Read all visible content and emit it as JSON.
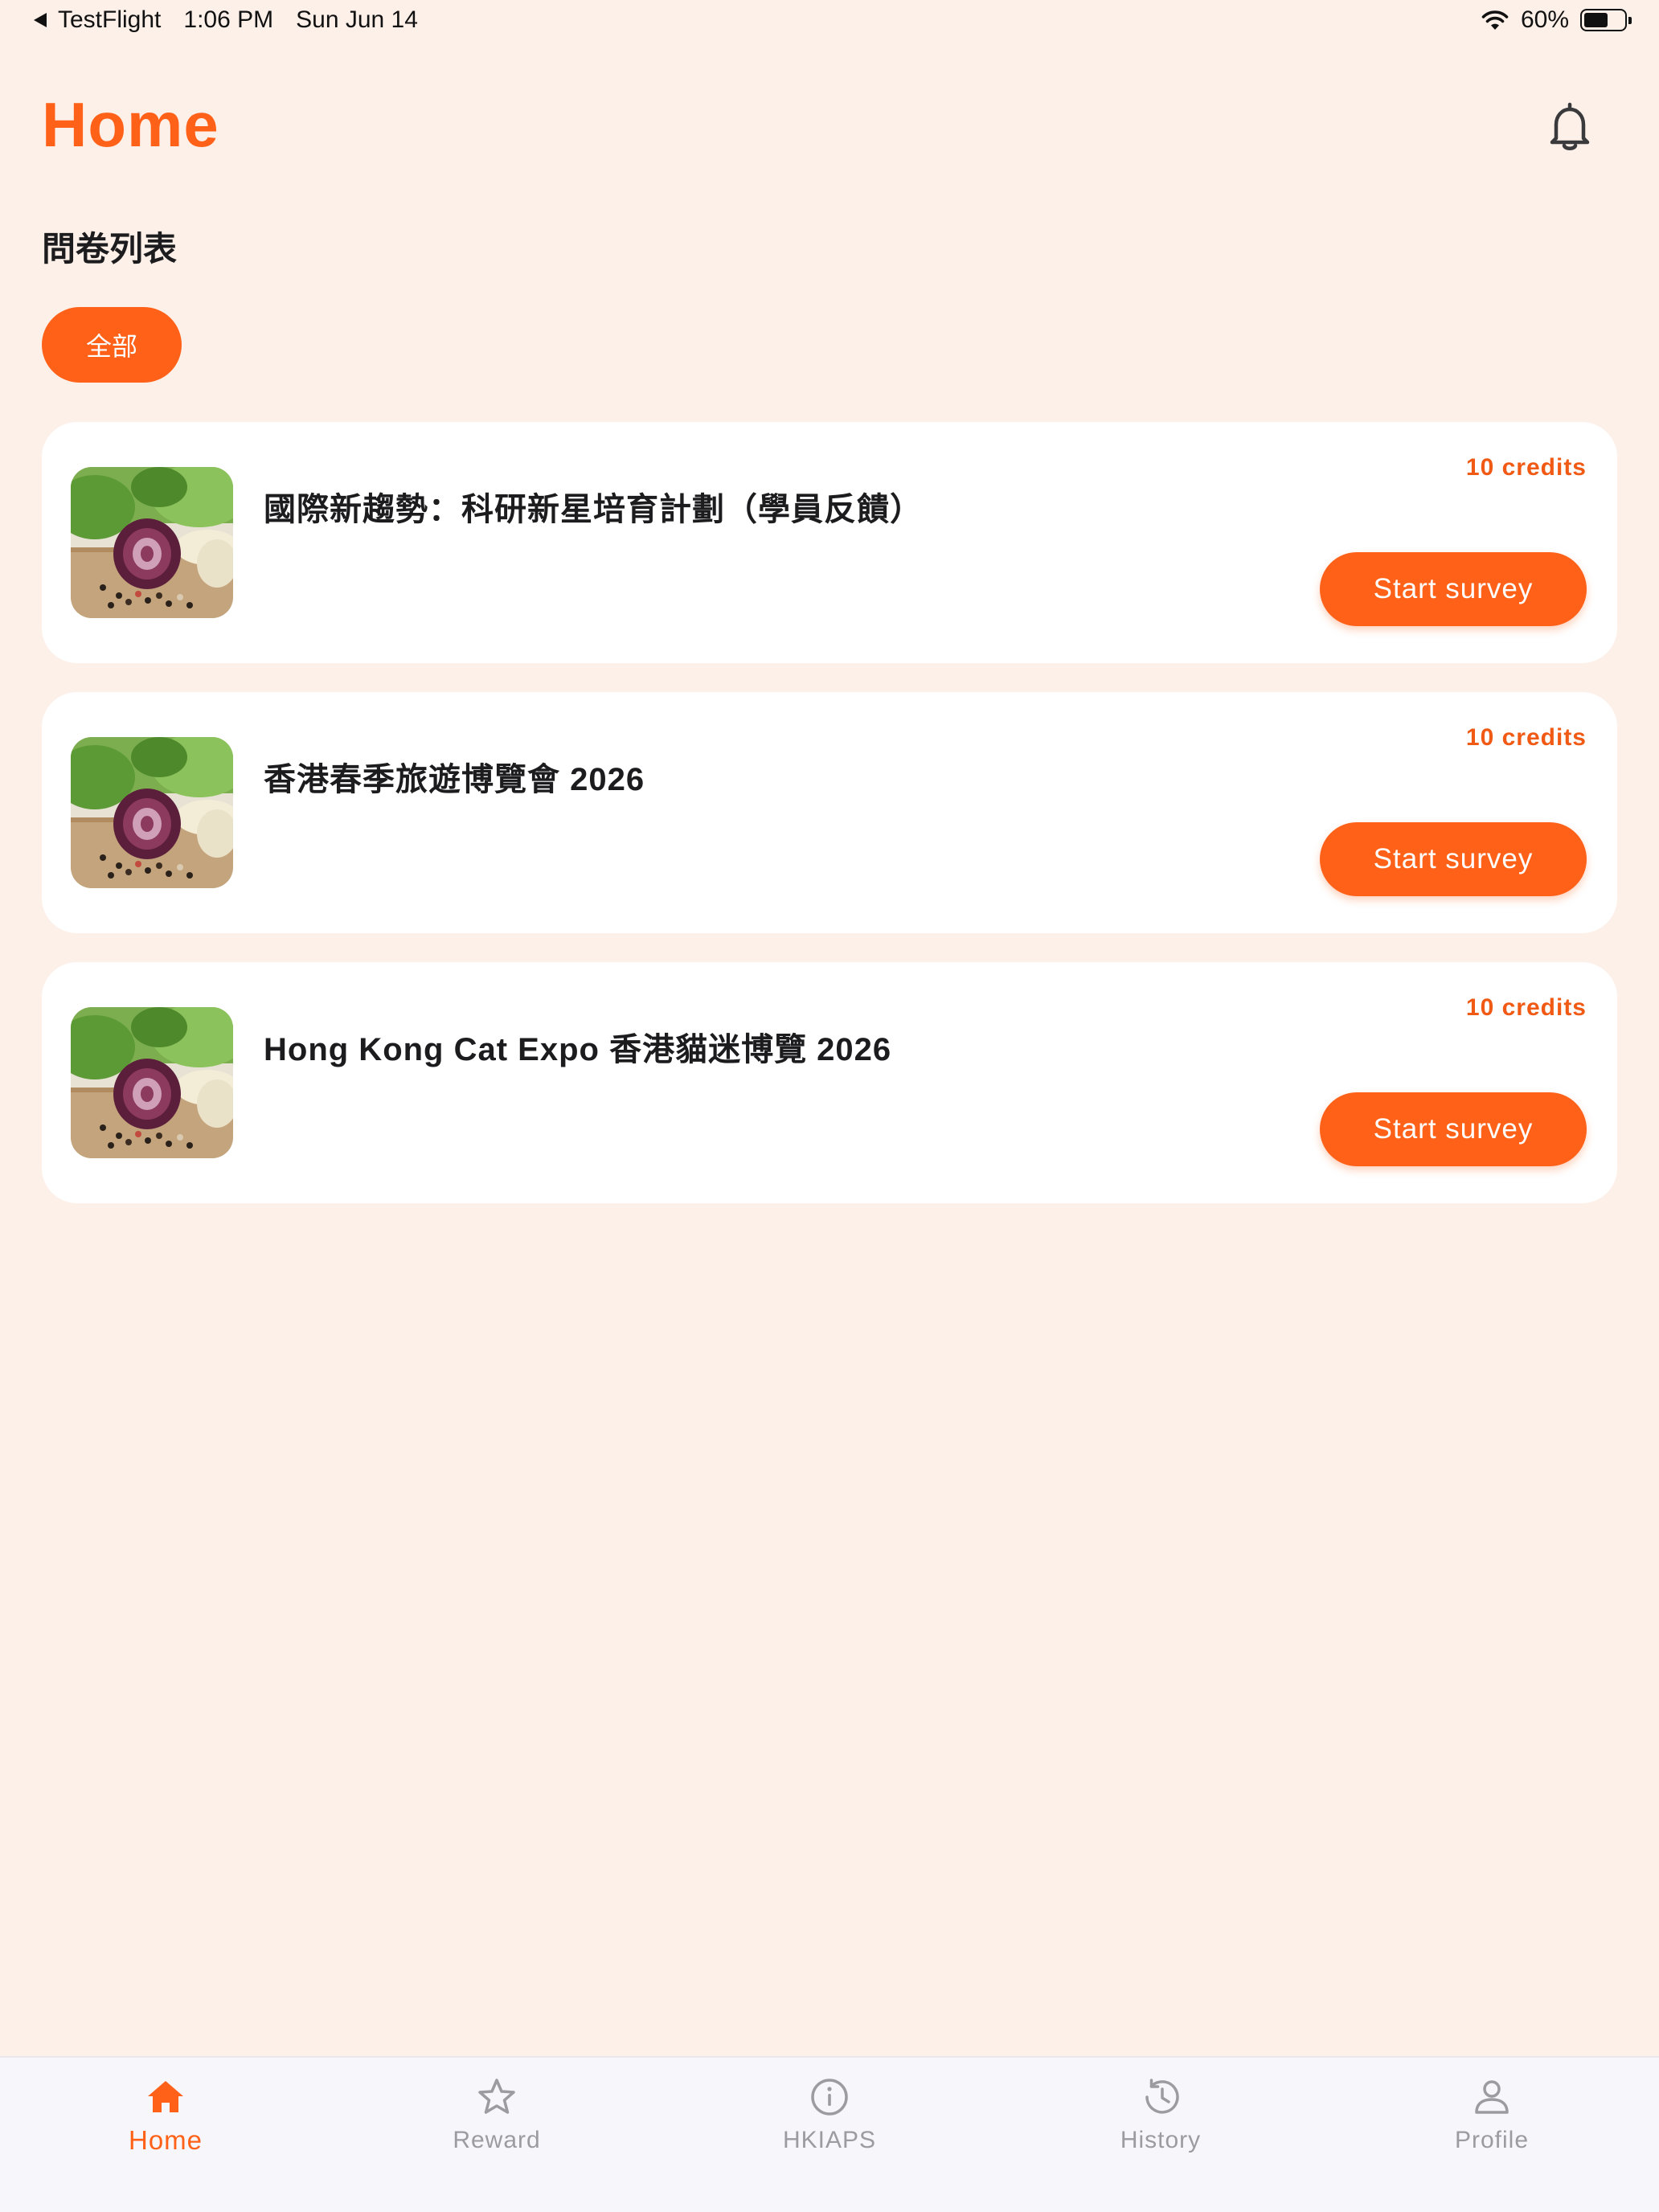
{
  "status_bar": {
    "back_app": "TestFlight",
    "time": "1:06 PM",
    "date": "Sun Jun 14",
    "battery_text": "60%",
    "battery_level": 0.6
  },
  "header": {
    "title": "Home",
    "bell_icon": "bell-icon"
  },
  "section": {
    "title": "問卷列表"
  },
  "filters": {
    "active_label": "全部"
  },
  "colors": {
    "accent": "#ff6118",
    "background": "#fdf0e9",
    "card": "#ffffff",
    "inactive_tab": "#9b9ba0"
  },
  "surveys": [
    {
      "title": "國際新趨勢：科研新星培育計劃（學員反饋）",
      "credits": "10 credits",
      "button_label": "Start survey"
    },
    {
      "title": "香港春季旅遊博覽會 2026",
      "credits": "10 credits",
      "button_label": "Start survey"
    },
    {
      "title": "Hong Kong Cat Expo 香港貓迷博覽 2026",
      "credits": "10 credits",
      "button_label": "Start survey"
    }
  ],
  "tabs": [
    {
      "label": "Home",
      "icon": "home-icon",
      "active": true
    },
    {
      "label": "Reward",
      "icon": "star-icon",
      "active": false
    },
    {
      "label": "HKIAPS",
      "icon": "info-icon",
      "active": false
    },
    {
      "label": "History",
      "icon": "history-icon",
      "active": false
    },
    {
      "label": "Profile",
      "icon": "person-icon",
      "active": false
    }
  ]
}
